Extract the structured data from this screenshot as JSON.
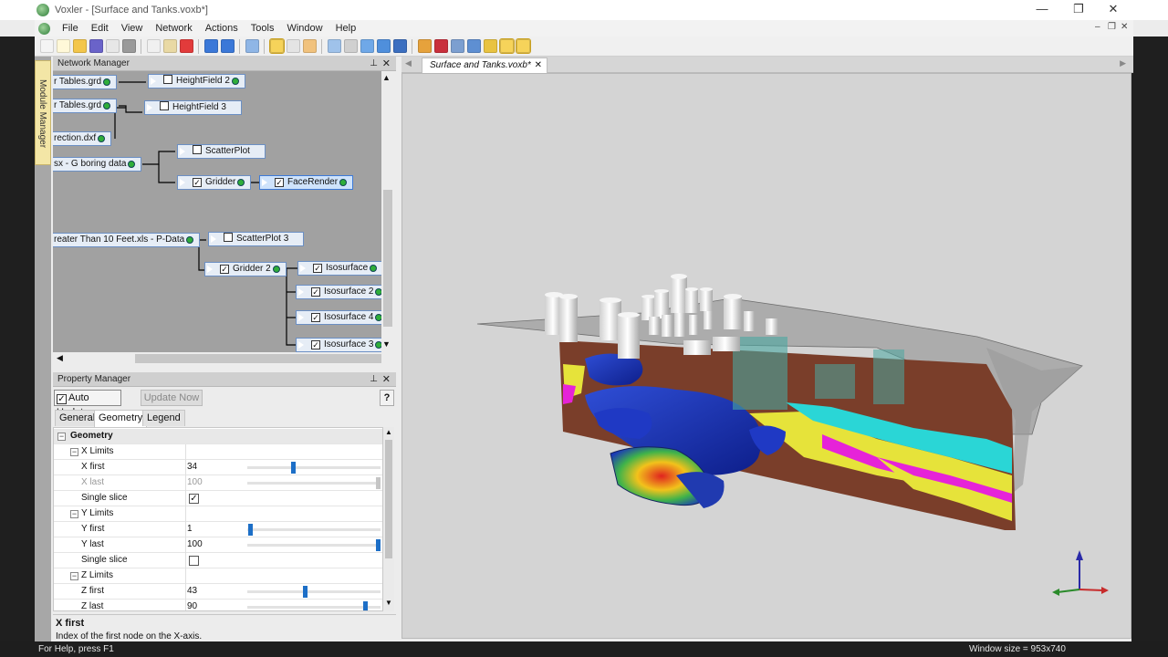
{
  "window": {
    "title": "Voxler - [Surface and Tanks.voxb*]",
    "minimize": "—",
    "restore": "❐",
    "close": "✕"
  },
  "menu": [
    "File",
    "Edit",
    "View",
    "Network",
    "Actions",
    "Tools",
    "Window",
    "Help"
  ],
  "mdi_controls": {
    "minimize": "–",
    "restore": "❐",
    "close": "✕"
  },
  "module_manager_label": "Module Manager",
  "network_manager": {
    "title": "Network Manager",
    "nodes": [
      {
        "label": "r Tables.grd",
        "checkbox": null
      },
      {
        "label": "HeightField 2",
        "checkbox": false
      },
      {
        "label": "r Tables.grd",
        "checkbox": null
      },
      {
        "label": "HeightField 3",
        "checkbox": false
      },
      {
        "label": "rection.dxf",
        "checkbox": null
      },
      {
        "label": "sx - G boring data",
        "checkbox": null
      },
      {
        "label": "ScatterPlot",
        "checkbox": false
      },
      {
        "label": "Gridder",
        "checkbox": true
      },
      {
        "label": "FaceRender",
        "checkbox": true
      },
      {
        "label": "reater Than 10 Feet.xls - P-Data",
        "checkbox": null
      },
      {
        "label": "ScatterPlot 3",
        "checkbox": false
      },
      {
        "label": "Gridder 2",
        "checkbox": true
      },
      {
        "label": "Isosurface",
        "checkbox": true
      },
      {
        "label": "Isosurface 2",
        "checkbox": true
      },
      {
        "label": "Isosurface 4",
        "checkbox": true
      },
      {
        "label": "Isosurface 3",
        "checkbox": true
      }
    ]
  },
  "property_manager": {
    "title": "Property Manager",
    "auto_update": "Auto Update",
    "update_now": "Update Now",
    "help": "?",
    "tabs": [
      "General",
      "Geometry",
      "Legend"
    ],
    "active_tab": "Geometry",
    "rows": [
      {
        "label": "Geometry",
        "value": ""
      },
      {
        "label": "X Limits",
        "value": ""
      },
      {
        "label": "X first",
        "value": "34",
        "slider": 0.34
      },
      {
        "label": "X last",
        "value": "100",
        "slider": 1.0
      },
      {
        "label": "Single slice",
        "value": "",
        "checked": true
      },
      {
        "label": "Y Limits",
        "value": ""
      },
      {
        "label": "Y first",
        "value": "1",
        "slider": 0.01
      },
      {
        "label": "Y last",
        "value": "100",
        "slider": 1.0
      },
      {
        "label": "Single slice",
        "value": "",
        "checked": false
      },
      {
        "label": "Z Limits",
        "value": ""
      },
      {
        "label": "Z first",
        "value": "43",
        "slider": 0.43
      },
      {
        "label": "Z last",
        "value": "90",
        "slider": 0.9
      }
    ],
    "help_title": "X first",
    "help_text": "Index of the first node on the X-axis."
  },
  "document_tab": {
    "label": "Surface and Tanks.voxb*",
    "close": "✕"
  },
  "status": {
    "left": "For Help, press F1",
    "right": "Window size = 953x740"
  },
  "colors": {
    "accent": "#1d6fc7",
    "node_border": "#6b8fc4",
    "port": "#2fae3a",
    "viewport_bg": "#d4d4d4"
  }
}
